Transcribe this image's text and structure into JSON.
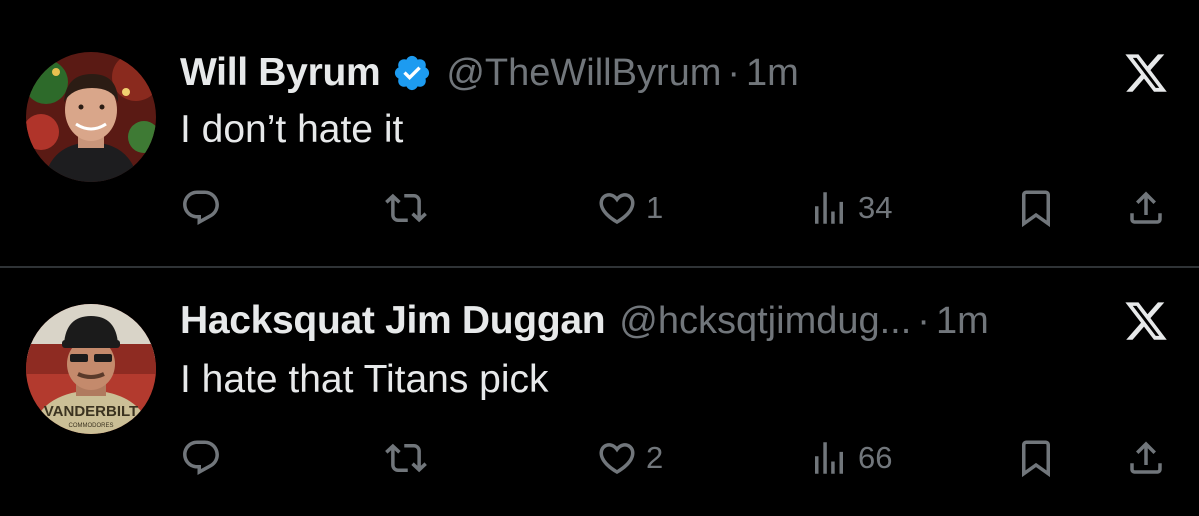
{
  "tweets": [
    {
      "display_name": "Will Byrum",
      "verified": true,
      "handle": "@TheWillByrum",
      "separator": "·",
      "time": "1m",
      "text": "I don’t hate it",
      "reply_count": "",
      "retweet_count": "",
      "like_count": "1",
      "view_count": "34"
    },
    {
      "display_name": "Hacksquat Jim Duggan",
      "verified": false,
      "handle": "@hcksqtjimdug...",
      "separator": "·",
      "time": "1m",
      "text": "I hate that Titans pick",
      "reply_count": "",
      "retweet_count": "",
      "like_count": "2",
      "view_count": "66",
      "avatar_text": "VANDERBILT",
      "avatar_subtext": "COMMODORES"
    }
  ],
  "colors": {
    "background": "#000000",
    "primary_text": "#e7e9ea",
    "secondary_text": "#71767b",
    "verified_blue": "#1d9bf0",
    "divider": "#2f3336"
  },
  "icons": [
    "reply-icon",
    "retweet-icon",
    "like-icon",
    "views-icon",
    "bookmark-icon",
    "share-icon",
    "x-logo-icon",
    "verified-badge-icon"
  ]
}
